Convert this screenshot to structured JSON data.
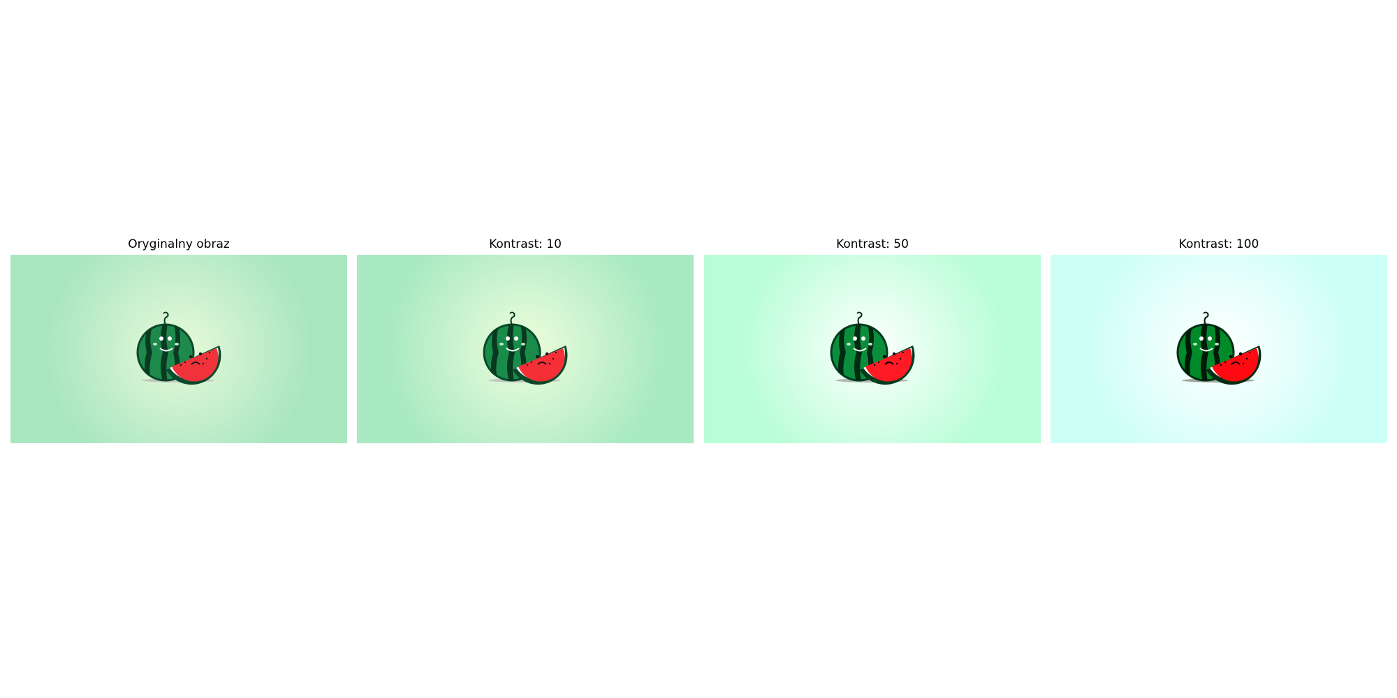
{
  "figure": {
    "panels": [
      {
        "title": "Oryginalny obraz",
        "contrast": null,
        "colors": {
          "bg_outer": "#a8e6c0",
          "bg_mid": "#c4eecc",
          "bg_center": "#e8fbd8",
          "rind_dark": "#0b4a2c",
          "rind_light": "#1d8a4c",
          "stripe": "#0a3b22",
          "flesh": "#f0333a",
          "flesh_edge": "#0b4a2c",
          "face": "#1a1a1a",
          "shadow": "#c0c8c0"
        }
      },
      {
        "title": "Kontrast: 10",
        "contrast": 10,
        "colors": {
          "bg_outer": "#aaeac2",
          "bg_mid": "#c8f2cf",
          "bg_center": "#eefedb",
          "rind_dark": "#084a2a",
          "rind_light": "#1a8c4a",
          "stripe": "#08381f",
          "flesh": "#f52f36",
          "flesh_edge": "#084a2a",
          "face": "#141414",
          "shadow": "#c0c8c0"
        }
      },
      {
        "title": "Kontrast: 50",
        "contrast": 50,
        "colors": {
          "bg_outer": "#b8fdd8",
          "bg_mid": "#d6ffe6",
          "bg_center": "#ffffff",
          "rind_dark": "#003d1e",
          "rind_light": "#0a8e3c",
          "stripe": "#002a12",
          "flesh": "#ff1a24",
          "flesh_edge": "#003d1e",
          "face": "#000000",
          "shadow": "#b0b8b0"
        }
      },
      {
        "title": "Kontrast: 100",
        "contrast": 100,
        "colors": {
          "bg_outer": "#ccfff6",
          "bg_mid": "#e4fffb",
          "bg_center": "#ffffff",
          "rind_dark": "#002e12",
          "rind_light": "#008a2a",
          "stripe": "#001a08",
          "flesh": "#ff0a12",
          "flesh_edge": "#002e12",
          "face": "#000000",
          "shadow": "#a0a8a0"
        }
      }
    ]
  }
}
